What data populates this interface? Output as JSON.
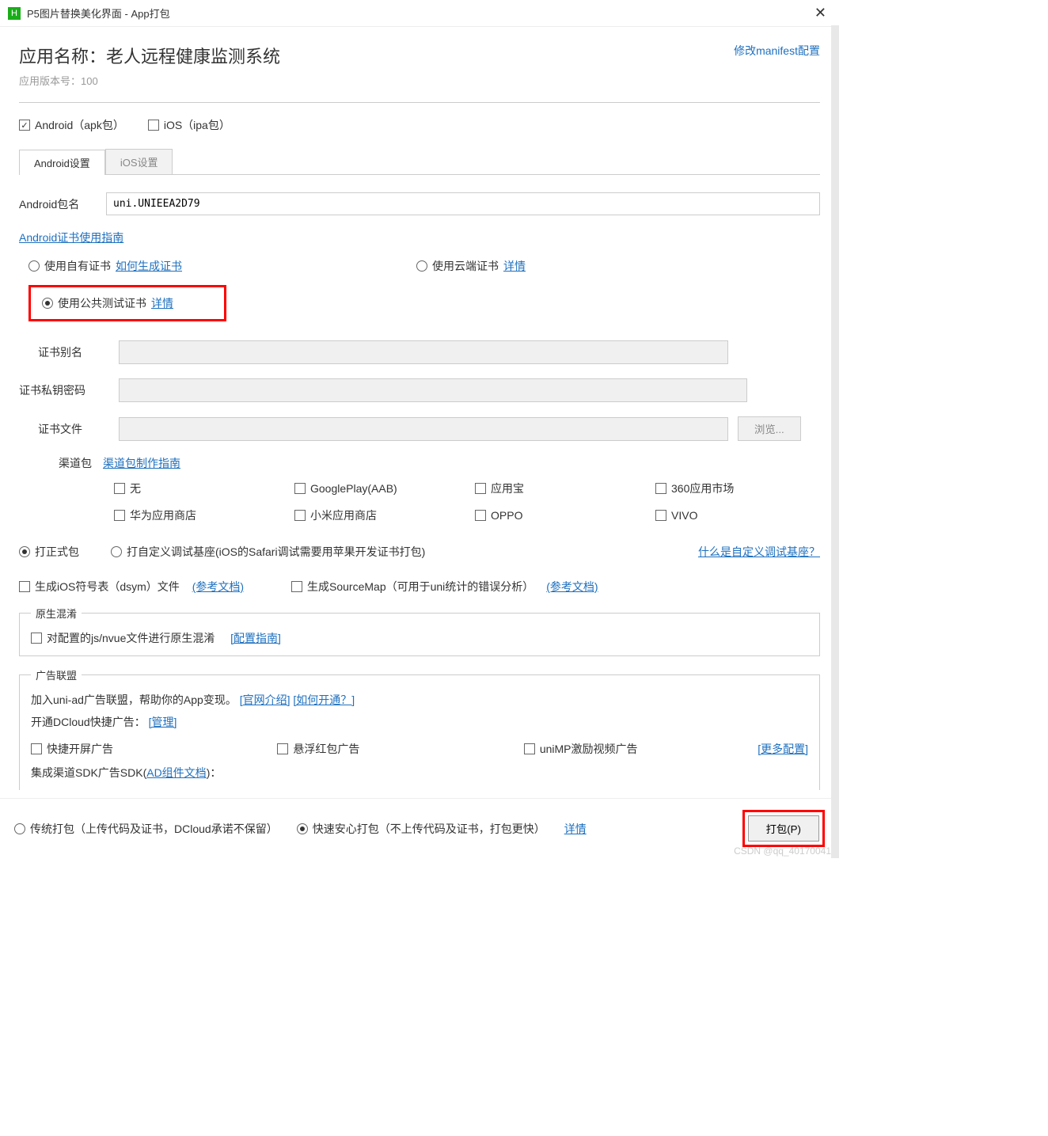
{
  "window": {
    "title": "P5图片替换美化界面 - App打包",
    "app_icon_letter": "H"
  },
  "header": {
    "app_name_label": "应用名称：",
    "app_name_value": "老人远程健康监测系统",
    "version_label": "应用版本号：",
    "version_value": "100",
    "manifest_link": "修改manifest配置"
  },
  "platform": {
    "android_label": "Android（apk包）",
    "ios_label": "iOS（ipa包）"
  },
  "tabs": {
    "android": "Android设置",
    "ios": "iOS设置"
  },
  "android": {
    "package_label": "Android包名",
    "package_value": "uni.UNIEEA2D79",
    "cert_guide_link": "Android证书使用指南",
    "cert_options": {
      "own": "使用自有证书",
      "own_link": "如何生成证书",
      "cloud": "使用云端证书",
      "cloud_link": "详情",
      "public": "使用公共测试证书",
      "public_link": "详情"
    },
    "cert_fields": {
      "alias": "证书别名",
      "key_pwd": "证书私钥密码",
      "file": "证书文件",
      "browse": "浏览..."
    },
    "channel": {
      "label": "渠道包",
      "guide_link": "渠道包制作指南",
      "items": [
        "无",
        "GooglePlay(AAB)",
        "应用宝",
        "360应用市场",
        "华为应用商店",
        "小米应用商店",
        "OPPO",
        "VIVO"
      ]
    }
  },
  "build": {
    "official": "打正式包",
    "custom": "打自定义调试基座(iOS的Safari调试需要用苹果开发证书打包)",
    "what_link": "什么是自定义调试基座？"
  },
  "misc": {
    "dsym": "生成iOS符号表（dsym）文件",
    "dsym_link": "(参考文档)",
    "sourcemap": "生成SourceMap（可用于uni统计的错误分析）",
    "sourcemap_link": "(参考文档)"
  },
  "native_obfus": {
    "legend": "原生混淆",
    "check": "对配置的js/nvue文件进行原生混淆",
    "link": "[配置指南]"
  },
  "ad": {
    "legend": "广告联盟",
    "line1_prefix": "加入uni-ad广告联盟，帮助你的App变现。",
    "line1_link1": "[官网介绍]",
    "line1_link2": "[如何开通？]",
    "line2_prefix": "开通DCloud快捷广告：",
    "line2_link": "[管理]",
    "items": [
      "快捷开屏广告",
      "悬浮红包广告",
      "uniMP激励视频广告"
    ],
    "more_link": "[更多配置]",
    "sdk_prefix": "集成渠道SDK广告SDK(",
    "sdk_link": "AD组件文档",
    "sdk_suffix": ")："
  },
  "bottom": {
    "traditional": "传统打包（上传代码及证书，DCloud承诺不保留）",
    "fast": "快速安心打包（不上传代码及证书，打包更快）",
    "detail_link": "详情",
    "pack_btn": "打包(P)"
  },
  "watermark": "CSDN @qq_40170041"
}
